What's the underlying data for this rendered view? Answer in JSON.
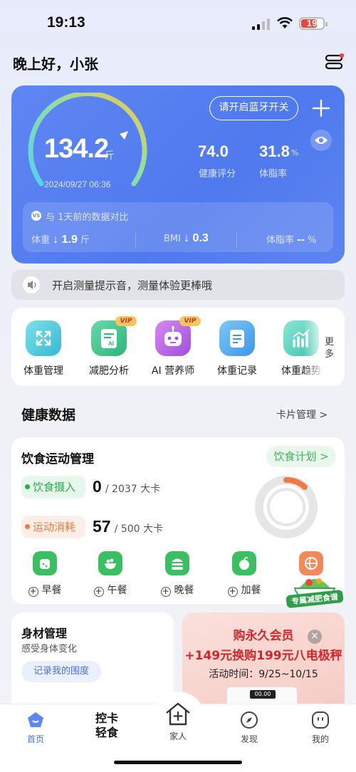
{
  "status_bar": {
    "time": "19:13",
    "battery": "19"
  },
  "header": {
    "greeting": "晚上好，小张"
  },
  "weight_card": {
    "weight": "134.2",
    "unit": "斤",
    "datetime": "2024/09/27 06:36",
    "bluetooth_button": "请开启蓝牙开关",
    "health_score": "74.0",
    "health_score_label": "健康评分",
    "body_fat": "31.8",
    "body_fat_unit": "%",
    "body_fat_label": "体脂率",
    "compare": {
      "badge": "VS",
      "title": "与 1天前的数据对比",
      "weight_label": "体重",
      "weight_delta": "↓ 1.9",
      "weight_unit": "斤",
      "bmi_label": "BMI",
      "bmi_delta": "↓ 0.3",
      "fat_label": "体脂率",
      "fat_delta": "--",
      "fat_unit": "%"
    }
  },
  "tip": {
    "text": "开启测量提示音，测量体验更棒哦"
  },
  "tools": {
    "items": [
      {
        "label": "体重管理"
      },
      {
        "label": "减肥分析",
        "badge": "VIP"
      },
      {
        "label": "AI 营养师",
        "badge": "VIP"
      },
      {
        "label": "体重记录"
      },
      {
        "label": "体重趋势"
      }
    ],
    "more": "更多"
  },
  "health_section": {
    "title": "健康数据",
    "manage_link": "卡片管理 >"
  },
  "diet_card": {
    "title": "饮食运动管理",
    "plan_button": "饮食计划 >",
    "intake_label": "饮食摄入",
    "intake_value": "0",
    "intake_target": "/ 2037 大卡",
    "burn_label": "运动消耗",
    "burn_value": "57",
    "burn_target": "/ 500 大卡",
    "meals": [
      {
        "label": "早餐"
      },
      {
        "label": "午餐"
      },
      {
        "label": "晚餐"
      },
      {
        "label": "加餐"
      }
    ],
    "recipe_badge": "专属减肥食谱"
  },
  "body_card": {
    "title": "身材管理",
    "subtitle": "感受身体变化",
    "button": "记录我的围度"
  },
  "promo": {
    "line1": "购永久会员",
    "line2": "+149元换购199元八电极秤",
    "line3": "活动时间：9/25~10/15",
    "scale_digits": "00.00"
  },
  "nav": {
    "items": [
      {
        "label": "首页"
      },
      {
        "label": "控卡\n轻食"
      },
      {
        "label": "家人"
      },
      {
        "label": "发现"
      },
      {
        "label": "我的"
      }
    ]
  },
  "colors": {
    "primary": "#5f86f2",
    "green": "#3cb55a",
    "orange": "#ef7a43",
    "promo_red": "#d4252a"
  }
}
